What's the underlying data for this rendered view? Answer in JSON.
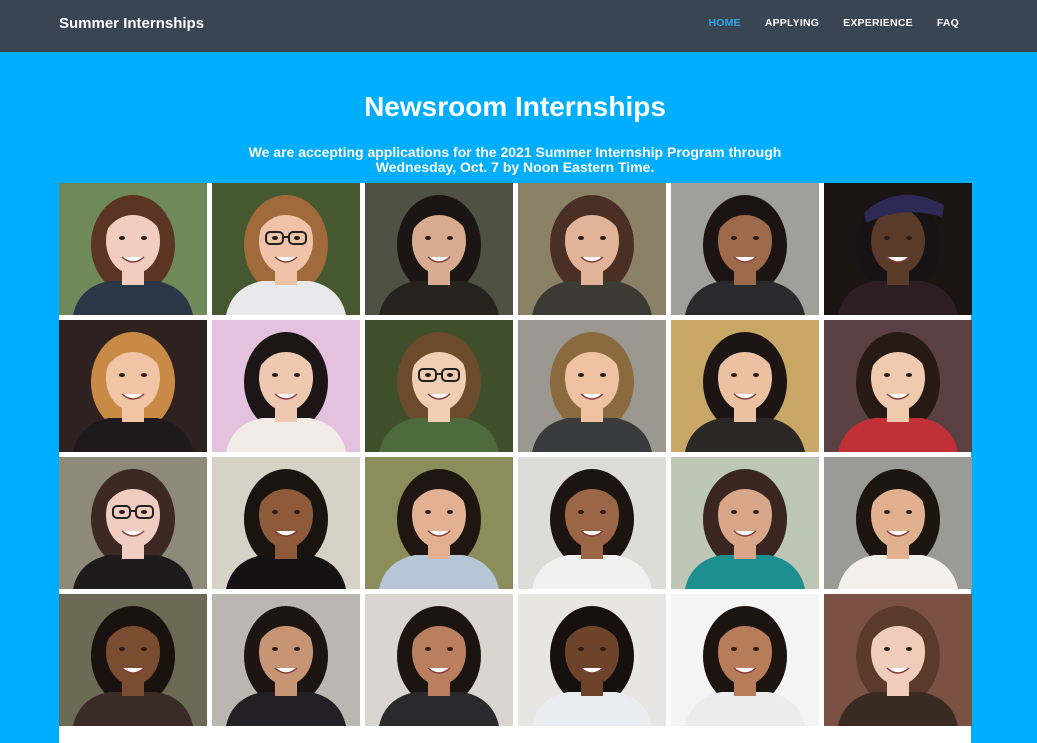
{
  "site": {
    "brand": "Summer Internships"
  },
  "nav": {
    "items": [
      {
        "label": "HOME",
        "active": true
      },
      {
        "label": "APPLYING",
        "active": false
      },
      {
        "label": "EXPERIENCE",
        "active": false
      },
      {
        "label": "FAQ",
        "active": false
      }
    ]
  },
  "hero": {
    "title": "Newsroom Internships",
    "subtitle_line1": "We are accepting applications for the 2021 Summer Internship Program through",
    "subtitle_line2": "Wednesday, Oct. 7 by Noon Eastern Time."
  },
  "colors": {
    "nav_bg": "#3a4553",
    "page_bg": "#00aeff",
    "accent": "#2ea7e8"
  },
  "intern_photos": [
    {
      "bg": "#6f8a58",
      "skin": "#f1cdbf",
      "hair": "#5b3424",
      "shirt": "#2b3647",
      "glasses": false,
      "hat": false
    },
    {
      "bg": "#45582f",
      "skin": "#f0c3a8",
      "hair": "#a06a3a",
      "shirt": "#e9e9ec",
      "glasses": true,
      "hat": false
    },
    {
      "bg": "#4f5143",
      "skin": "#d8ab90",
      "hair": "#1b1614",
      "shirt": "#26231f",
      "glasses": false,
      "hat": false
    },
    {
      "bg": "#8a8167",
      "skin": "#e1b49a",
      "hair": "#4a3024",
      "shirt": "#3c3a35",
      "glasses": false,
      "hat": false
    },
    {
      "bg": "#9fa09b",
      "skin": "#9d6b4c",
      "hair": "#1c1412",
      "shirt": "#2a2a2c",
      "glasses": false,
      "hat": false
    },
    {
      "bg": "#1a1413",
      "skin": "#5a3a29",
      "hair": "#171214",
      "shirt": "#2e1d22",
      "glasses": false,
      "hat": true
    },
    {
      "bg": "#2e2220",
      "skin": "#f0c4a5",
      "hair": "#c98a45",
      "shirt": "#1e1a1c",
      "glasses": false,
      "hat": false
    },
    {
      "bg": "#e4c1de",
      "skin": "#efc8b2",
      "hair": "#1c1617",
      "shirt": "#f1ece6",
      "glasses": false,
      "hat": false
    },
    {
      "bg": "#3f4f2c",
      "skin": "#f1cdb3",
      "hair": "#6c4a2c",
      "shirt": "#4e6b3e",
      "glasses": true,
      "hat": false
    },
    {
      "bg": "#9a9890",
      "skin": "#efc2a4",
      "hair": "#8b6a3f",
      "shirt": "#3a3b3d",
      "glasses": false,
      "hat": false
    },
    {
      "bg": "#c9a766",
      "skin": "#ecc1a2",
      "hair": "#1d1514",
      "shirt": "#2a2927",
      "glasses": false,
      "hat": false
    },
    {
      "bg": "#5a3f43",
      "skin": "#efcaaf",
      "hair": "#271a14",
      "shirt": "#c13037",
      "glasses": false,
      "hat": false
    },
    {
      "bg": "#8e8a7a",
      "skin": "#f1cdc1",
      "hair": "#3c2a22",
      "shirt": "#1e1b1c",
      "glasses": true,
      "hat": false
    },
    {
      "bg": "#d7d2c6",
      "skin": "#8e5a3a",
      "hair": "#1a1411",
      "shirt": "#141213",
      "glasses": false,
      "hat": false
    },
    {
      "bg": "#8b8e5a",
      "skin": "#e2b192",
      "hair": "#1f1611",
      "shirt": "#b7c6d6",
      "glasses": false,
      "hat": false
    },
    {
      "bg": "#dcdcd8",
      "skin": "#9a6645",
      "hair": "#1c1410",
      "shirt": "#f1f1f1",
      "glasses": false,
      "hat": false
    },
    {
      "bg": "#bcc7b5",
      "skin": "#d9a689",
      "hair": "#3a2620",
      "shirt": "#1e8f8f",
      "glasses": false,
      "hat": false
    },
    {
      "bg": "#9a9a96",
      "skin": "#e0b08f",
      "hair": "#1c1510",
      "shirt": "#f3f0eb",
      "glasses": false,
      "hat": false
    },
    {
      "bg": "#6b6a55",
      "skin": "#7a4c30",
      "hair": "#1a120e",
      "shirt": "#3a2b26",
      "glasses": false,
      "hat": false
    },
    {
      "bg": "#b9b7b0",
      "skin": "#c79474",
      "hair": "#1d1512",
      "shirt": "#222024",
      "glasses": false,
      "hat": false
    },
    {
      "bg": "#d9d6d0",
      "skin": "#b97f5e",
      "hair": "#1c1411",
      "shirt": "#2a2a2d",
      "glasses": false,
      "hat": false
    },
    {
      "bg": "#e8e6e2",
      "skin": "#6e432c",
      "hair": "#16110e",
      "shirt": "#e9edf2",
      "glasses": false,
      "hat": false
    },
    {
      "bg": "#f4f4f4",
      "skin": "#b77c5a",
      "hair": "#1b1411",
      "shirt": "#ececec",
      "glasses": false,
      "hat": false
    },
    {
      "bg": "#7b5143",
      "skin": "#f0cdbb",
      "hair": "#5a3a2a",
      "shirt": "#3a2a24",
      "glasses": false,
      "hat": false
    }
  ]
}
